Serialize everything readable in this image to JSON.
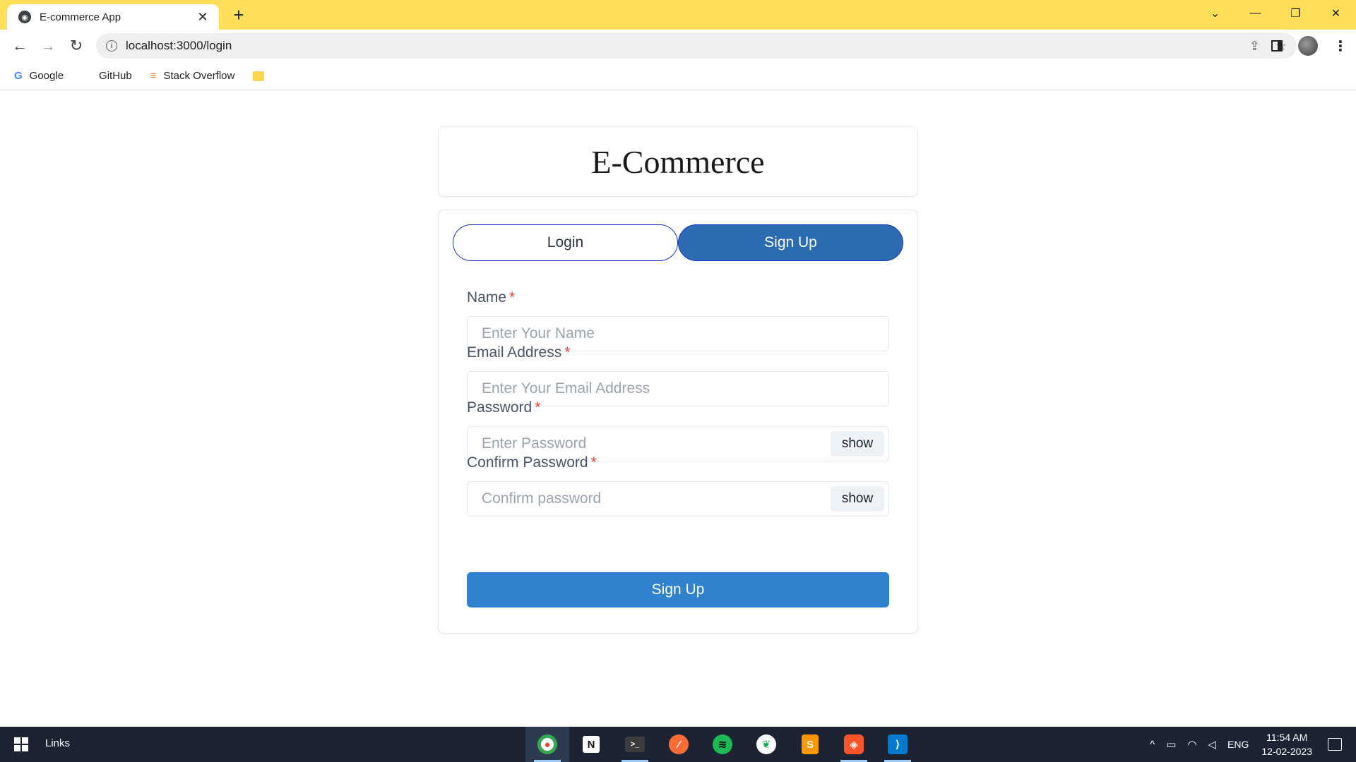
{
  "browser": {
    "tab_title": "E-commerce App",
    "tab_close": "✕",
    "new_tab": "+",
    "url": "localhost:3000/login",
    "window_controls": {
      "tab_search": "⌄",
      "minimize": "—",
      "restore": "❐",
      "close": "✕"
    },
    "toolbar": {
      "back": "←",
      "forward": "→",
      "reload": "↻",
      "share": "⇪",
      "bookmark": "☆",
      "menu": "⋮"
    },
    "bookmarks": [
      {
        "label": "Google",
        "icon": "google-icon"
      },
      {
        "label": "GitHub",
        "icon": "github-icon"
      },
      {
        "label": "Stack Overflow",
        "icon": "stackoverflow-icon"
      }
    ]
  },
  "page": {
    "brand": "E-Commerce",
    "tabs": [
      {
        "label": "Login",
        "active": false
      },
      {
        "label": "Sign Up",
        "active": true
      }
    ],
    "fields": {
      "name": {
        "label": "Name",
        "required": "*",
        "placeholder": "Enter Your Name"
      },
      "email": {
        "label": "Email Address",
        "required": "*",
        "placeholder": "Enter Your Email Address"
      },
      "password": {
        "label": "Password",
        "required": "*",
        "placeholder": "Enter Password",
        "toggle": "show"
      },
      "confirm": {
        "label": "Confirm Password",
        "required": "*",
        "placeholder": "Confirm password",
        "toggle": "show"
      }
    },
    "submit_label": "Sign Up"
  },
  "taskbar": {
    "label": "Links",
    "apps": [
      {
        "name": "chrome",
        "glyph": "●",
        "color": "#ea4335"
      },
      {
        "name": "notion",
        "glyph": "N",
        "color": "#ffffff"
      },
      {
        "name": "terminal",
        "glyph": ">_",
        "color": "#3c3c3c"
      },
      {
        "name": "postman",
        "glyph": "⁄",
        "color": "#ff6c37"
      },
      {
        "name": "spotify",
        "glyph": "≋",
        "color": "#1db954"
      },
      {
        "name": "mongodb-compass",
        "glyph": "❦",
        "color": "#ffffff"
      },
      {
        "name": "sublime-text",
        "glyph": "S",
        "color": "#ff9800"
      },
      {
        "name": "brave",
        "glyph": "◈",
        "color": "#fb542b"
      },
      {
        "name": "vscode",
        "glyph": "⟩",
        "color": "#007acc"
      }
    ],
    "tray": {
      "chevron": "^",
      "lang": "ENG",
      "time": "11:54 AM",
      "date": "12-02-2023"
    }
  }
}
